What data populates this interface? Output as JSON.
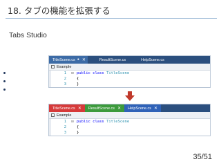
{
  "slide": {
    "title": "18. タブの機能を拡張する",
    "subtitle": "Tabs Studio",
    "page": "35/51"
  },
  "before": {
    "tabs": [
      {
        "label": "TitleScene.cs",
        "marker": "✕",
        "pin": "●"
      },
      {
        "label": "ResultScene.cs"
      },
      {
        "label": "HelpScene.cs"
      }
    ],
    "nav_label": "Example",
    "lines": [
      {
        "num": "1",
        "gutter": "⊟",
        "keyword": "public class",
        "type": "TitleScene"
      },
      {
        "num": "2",
        "gutter": "",
        "text": "{"
      },
      {
        "num": "3",
        "gutter": "",
        "text": "}"
      }
    ]
  },
  "after": {
    "tabs": [
      {
        "label": "TitleScene.cs",
        "marker": "✕"
      },
      {
        "label": "ResultScene.cs",
        "marker": "✕"
      },
      {
        "label": "HelpScene.cs",
        "marker": "✕"
      }
    ],
    "nav_label": "Example",
    "lines": [
      {
        "num": "1",
        "gutter": "⊟",
        "keyword": "public class",
        "type": "TitleScene"
      },
      {
        "num": "2",
        "gutter": "",
        "text": "{"
      },
      {
        "num": "3",
        "gutter": "",
        "text": "}"
      }
    ]
  },
  "colors": {
    "arrow": "#c0392b",
    "tab_title_after": "#d63a3a",
    "tab_result_after": "#3c9a3c",
    "tab_help_after": "#2f62b8",
    "tabbar_before": "#2b4f7e"
  }
}
